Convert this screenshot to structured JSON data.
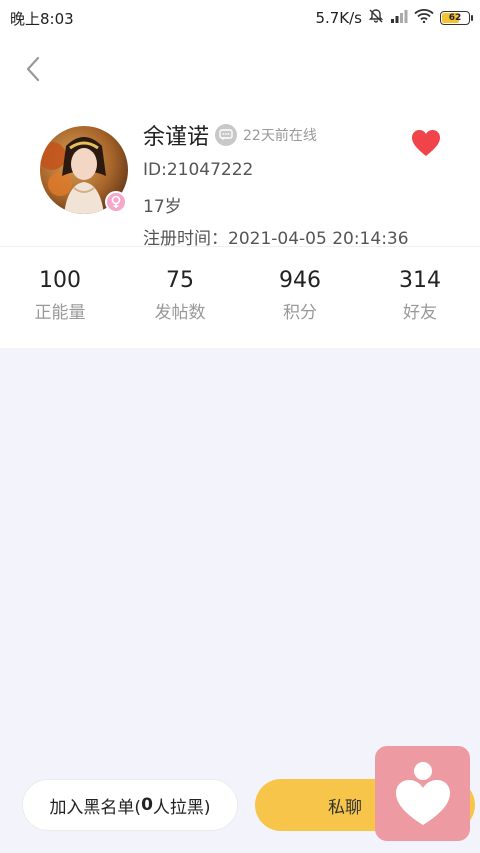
{
  "status_bar": {
    "time": "晚上8:03",
    "network_speed": "5.7K/s",
    "battery_level": "62",
    "battery_fill_fraction": 0.62,
    "icons": [
      "mute-icon",
      "signal-icon",
      "wifi-icon",
      "battery-icon"
    ]
  },
  "profile": {
    "name": "余谨诺",
    "online_status": "22天前在线",
    "id_line": "ID:21047222",
    "age": "17岁",
    "register_line": "注册时间：2021-04-05 20:14:36",
    "gender": "female"
  },
  "stats": [
    {
      "value": "100",
      "label": "正能量"
    },
    {
      "value": "75",
      "label": "发帖数"
    },
    {
      "value": "946",
      "label": "积分"
    },
    {
      "value": "314",
      "label": "好友"
    }
  ],
  "actions": {
    "blacklist_prefix": "加入黑名单(",
    "blacklist_count": "0",
    "blacklist_suffix": "人拉黑)",
    "chat_label": "私聊"
  },
  "colors": {
    "accent": "#f6c54a",
    "heart": "#f0434a",
    "widget": "#ee9aa3",
    "gender_badge": "#f6a6c8"
  }
}
